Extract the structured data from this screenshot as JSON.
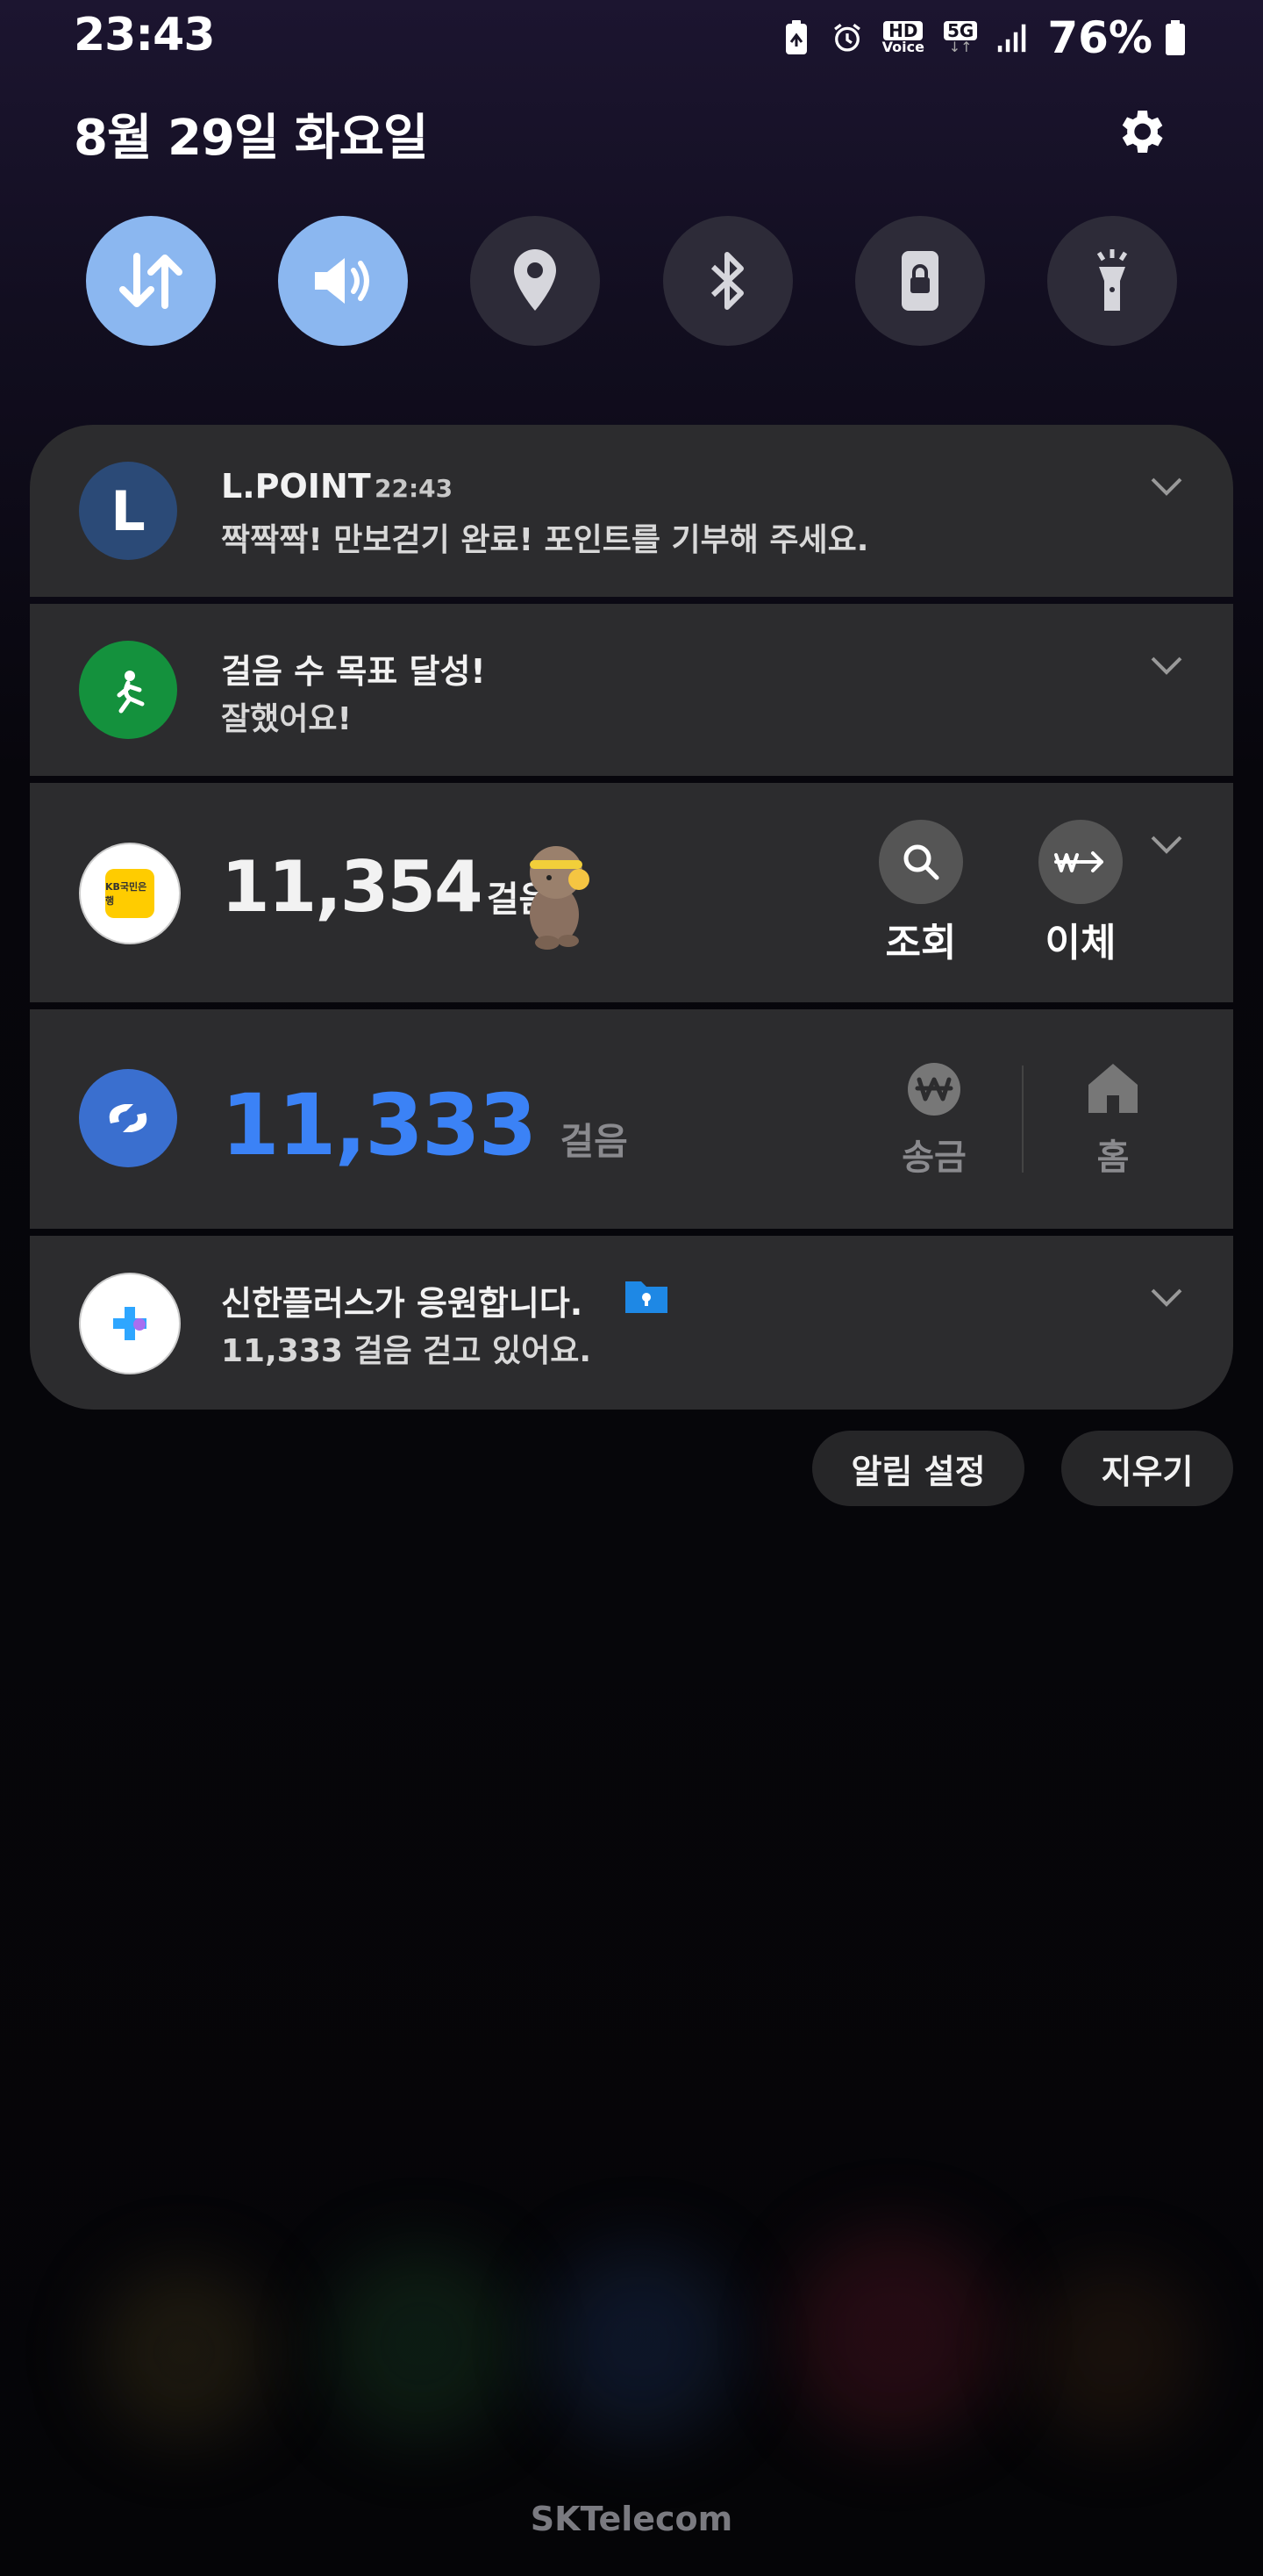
{
  "status": {
    "time": "23:43",
    "icons": [
      "recycle-battery-icon",
      "alarm-icon",
      "hd-voice-icon",
      "5g-icon",
      "signal-icon",
      "battery-icon"
    ],
    "hd_top": "HD",
    "hd_bottom": "Voice",
    "network": "5G",
    "battery": "76%"
  },
  "header": {
    "date": "8월 29일 화요일"
  },
  "toggles": [
    {
      "name": "mobile-data",
      "state": "on"
    },
    {
      "name": "sound",
      "state": "on"
    },
    {
      "name": "location",
      "state": "off"
    },
    {
      "name": "bluetooth",
      "state": "off"
    },
    {
      "name": "screen-lock-rotation",
      "state": "off"
    },
    {
      "name": "flashlight",
      "state": "off"
    }
  ],
  "notifications": {
    "lpoint": {
      "app": "L.POINT",
      "time": "22:43",
      "text": "짝짝짝! 만보걷기 완료! 포인트를 기부해 주세요.",
      "letter": "L"
    },
    "goal": {
      "title": "걸음 수 목표 달성!",
      "text": "잘했어요!"
    },
    "kb": {
      "steps": "11,354",
      "unit": "걸음",
      "action1": "조회",
      "action2": "이체",
      "logo": "KB국민은행"
    },
    "toss": {
      "steps": "11,333",
      "unit": "걸음",
      "action1": "송금",
      "action2": "홈"
    },
    "shinhan": {
      "title": "신한플러스가 응원합니다.",
      "text": "11,333 걸음 걷고 있어요."
    }
  },
  "buttons": {
    "settings": "알림 설정",
    "clear": "지우기"
  },
  "footer": {
    "carrier": "SKTelecom"
  },
  "colors": {
    "accent": "#8bb7f0",
    "toss_blue": "#3b82f6",
    "card": "#2c2c2e"
  }
}
